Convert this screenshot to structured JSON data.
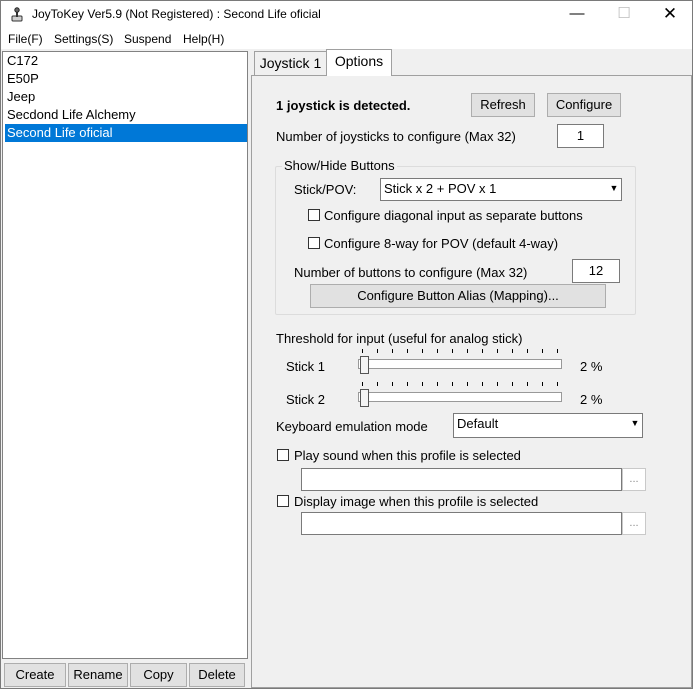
{
  "window": {
    "title": "JoyToKey Ver5.9 (Not Registered) : Second Life oficial",
    "controls": {
      "minimize": "—",
      "maximize": "☐",
      "close": "✕"
    }
  },
  "menu": [
    "File(F)",
    "Settings(S)",
    "Suspend",
    "Help(H)"
  ],
  "profiles": {
    "items": [
      "C172",
      "E50P",
      "Jeep",
      "Secdond Life Alchemy",
      "Second Life oficial"
    ],
    "selected_index": 4
  },
  "profile_buttons": {
    "create": "Create",
    "rename": "Rename",
    "copy": "Copy",
    "delete": "Delete"
  },
  "tabs": [
    {
      "label": "Joystick 1",
      "active": false
    },
    {
      "label": "Options",
      "active": true
    }
  ],
  "options": {
    "detected_text": "1 joystick is detected.",
    "refresh_label": "Refresh",
    "configure_label": "Configure",
    "num_joysticks_label": "Number of joysticks to configure (Max 32)",
    "num_joysticks_value": "1",
    "show_hide_group": {
      "title": "Show/Hide Buttons",
      "stick_pov_label": "Stick/POV:",
      "stick_pov_value": "Stick x 2 + POV x 1",
      "diagonal_label": "Configure diagonal input as separate buttons",
      "diagonal_checked": false,
      "pov8_label": "Configure 8-way for POV (default 4-way)",
      "pov8_checked": false,
      "num_buttons_label": "Number of buttons to configure (Max 32)",
      "num_buttons_value": "12",
      "alias_button_label": "Configure Button Alias (Mapping)..."
    },
    "threshold": {
      "label": "Threshold for input (useful for analog stick)",
      "stick1_label": "Stick 1",
      "stick1_value": "2 %",
      "stick1_level": 2,
      "stick2_label": "Stick 2",
      "stick2_value": "2 %",
      "stick2_level": 2
    },
    "keyboard_mode_label": "Keyboard emulation mode",
    "keyboard_mode_value": "Default",
    "play_sound_label": "Play sound when this profile is selected",
    "play_sound_checked": false,
    "sound_path": "",
    "display_image_label": "Display image when this profile is selected",
    "display_image_checked": false,
    "image_path": "",
    "browse_label": "..."
  },
  "icons": {
    "app": "joytokey-app-icon",
    "dropdown": "chevron-down-icon"
  }
}
